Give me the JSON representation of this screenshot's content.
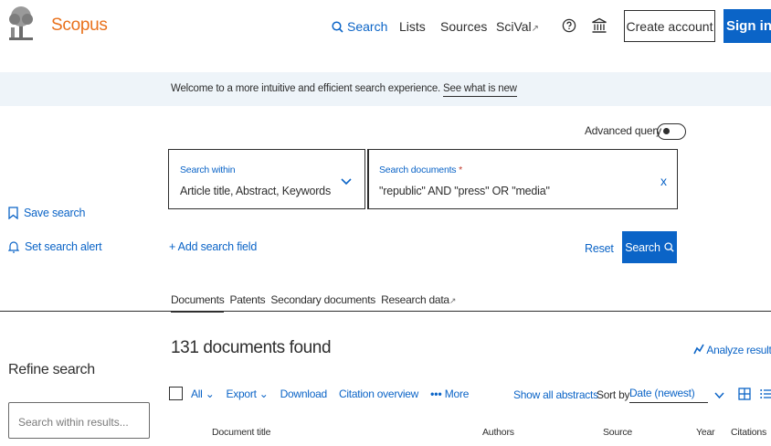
{
  "header": {
    "brand": "Scopus",
    "nav": {
      "search": "Search",
      "lists": "Lists",
      "sources": "Sources",
      "scival": "SciVal"
    },
    "create_account": "Create account",
    "sign_in": "Sign in"
  },
  "banner": {
    "text": "Welcome to a more intuitive and efficient search experience.",
    "link": "See what is new"
  },
  "advanced_query": "Advanced query",
  "sidebar": {
    "save_search": "Save search",
    "set_alert": "Set search alert",
    "refine_title": "Refine search",
    "refine_placeholder": "Search within results..."
  },
  "search": {
    "within_label": "Search within",
    "within_value": "Article title, Abstract, Keywords",
    "docs_label": "Search documents",
    "required_mark": "*",
    "docs_value": "\"republic\" AND \"press\" OR \"media\"",
    "clear": "x",
    "add_field": "+ Add search field",
    "reset": "Reset",
    "submit": "Search"
  },
  "tabs": [
    "Documents",
    "Patents",
    "Secondary documents",
    "Research data"
  ],
  "results": {
    "count": "131 documents found",
    "analyze": "Analyze results",
    "toolbar": {
      "all": "All",
      "export": "Export",
      "download": "Download",
      "citation_overview": "Citation overview",
      "more": "More"
    },
    "show_abstracts": "Show all abstracts",
    "sort_label": "Sort by",
    "sort_value": "Date (newest)",
    "columns": {
      "title": "Document title",
      "authors": "Authors",
      "source": "Source",
      "year": "Year",
      "citations": "Citations"
    }
  },
  "colors": {
    "accent": "#0b64c7",
    "brand": "#e9711c",
    "banner_bg": "#eef4f9"
  }
}
